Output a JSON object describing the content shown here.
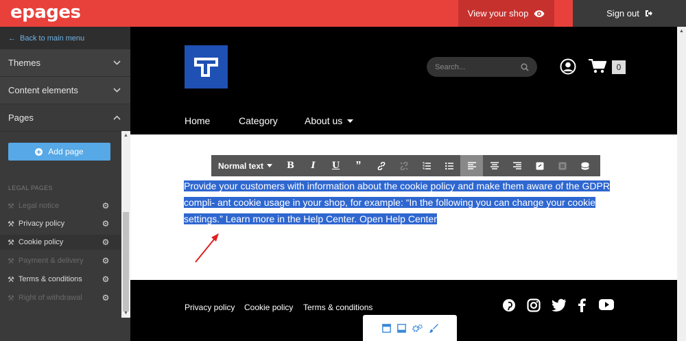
{
  "topbar": {
    "logo": "epages",
    "view_shop": "View your shop",
    "sign_out": "Sign out"
  },
  "sidebar": {
    "back": "Back to main menu",
    "themes": "Themes",
    "content_elements": "Content elements",
    "pages": "Pages",
    "add_page": "Add page",
    "legal_heading": "LEGAL PAGES",
    "items": [
      {
        "label": "Legal notice"
      },
      {
        "label": "Privacy policy"
      },
      {
        "label": "Cookie policy"
      },
      {
        "label": "Payment & delivery"
      },
      {
        "label": "Terms & conditions"
      },
      {
        "label": "Right of withdrawal"
      }
    ]
  },
  "shop": {
    "search_placeholder": "Search...",
    "cart_count": "0",
    "nav": [
      "Home",
      "Category",
      "About us"
    ],
    "toolbar_format": "Normal text",
    "selected_text": "Provide your customers with information about the cookie policy and make them aware of the GDPR compli- ant cookie usage in your shop, for example: “In the following you can change your cookie settings.” Learn more in the Help Center. Open Help Center",
    "footer_links": [
      "Privacy policy",
      "Cookie policy",
      "Terms & conditions"
    ]
  },
  "colors": {
    "brand_red": "#e8403b",
    "accent_blue": "#56a8e6",
    "selection_blue": "#2f67d0",
    "shop_logo_blue": "#1f50b3"
  }
}
